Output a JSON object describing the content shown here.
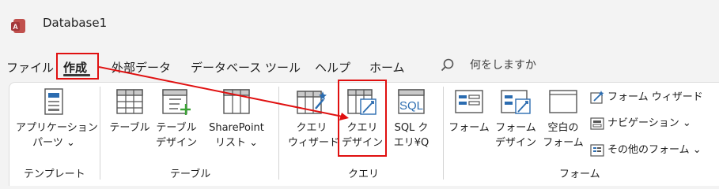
{
  "window": {
    "title": "Database1"
  },
  "tabs": [
    {
      "label": "ファイル"
    },
    {
      "label": "作成"
    },
    {
      "label": "外部データ"
    },
    {
      "label": "データベース ツール"
    },
    {
      "label": "ヘルプ"
    },
    {
      "label": "ホーム"
    }
  ],
  "search": {
    "placeholder": "何をしますか"
  },
  "ribbon": {
    "groups": {
      "template": "テンプレート",
      "table": "テーブル",
      "query": "クエリ",
      "form": "フォーム"
    },
    "buttons": {
      "app_parts": [
        "アプリケーション",
        "パーツ ⌄"
      ],
      "table": [
        "テーブル"
      ],
      "table_design": [
        "テーブル",
        "デザイン"
      ],
      "sharepoint_list": [
        "SharePoint",
        "リスト ⌄"
      ],
      "query_wizard": [
        "クエリ",
        "ウィザード"
      ],
      "query_design": [
        "クエリ",
        "デザイン"
      ],
      "sql_query": [
        "SQL ク",
        "エリ¥Q"
      ],
      "form": [
        "フォーム"
      ],
      "form_design": [
        "フォーム",
        "デザイン"
      ],
      "blank_form": [
        "空白の",
        "フォーム"
      ],
      "form_wizard": "フォーム ウィザード",
      "navigation": "ナビゲーション ⌄",
      "more_forms": "その他のフォーム ⌄"
    }
  },
  "colors": {
    "highlight": "#e01010",
    "accent": "#a4373a",
    "icon_blue": "#2b6cb0"
  }
}
